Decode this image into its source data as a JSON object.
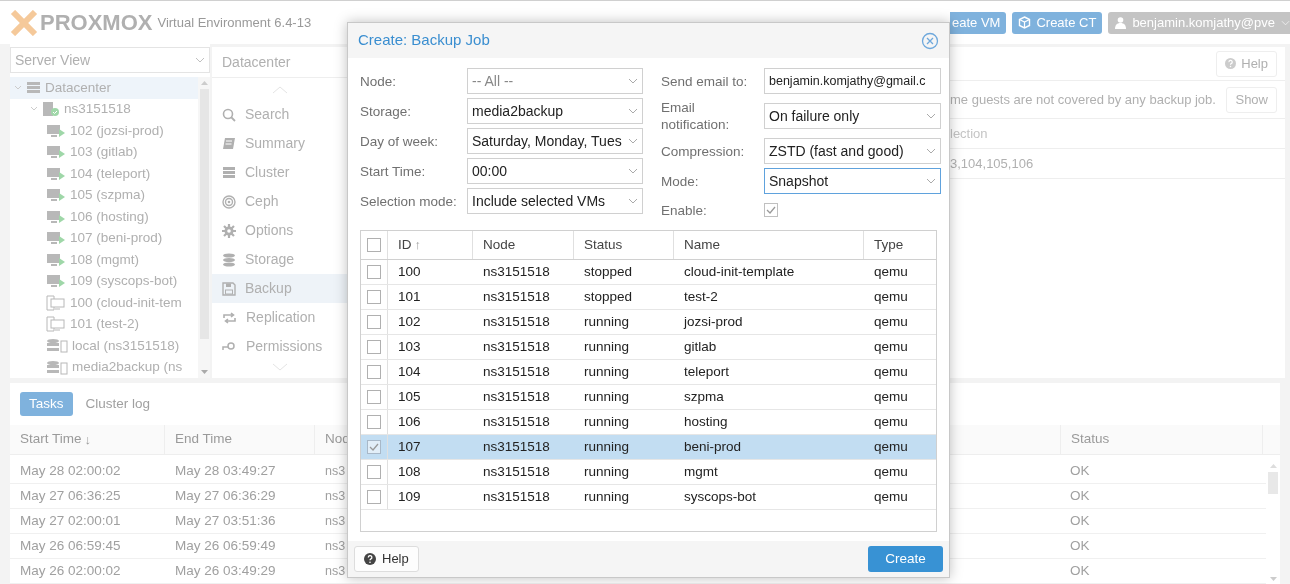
{
  "header": {
    "logo": "PROXMOX",
    "subtitle": "Virtual Environment 6.4-13",
    "buttons": [
      {
        "label": "eate VM",
        "kind": "plain"
      },
      {
        "label": "Create CT",
        "kind": "cube"
      }
    ],
    "user": "benjamin.komjathy@pve"
  },
  "tree": {
    "view_selector": "Server View",
    "items": [
      {
        "label": "Datacenter",
        "kind": "datacenter",
        "selected": true,
        "expanded": true,
        "children": [
          {
            "label": "ns3151518",
            "kind": "node",
            "selected": false,
            "expanded": true,
            "children": [
              {
                "label": "102 (jozsi-prod)",
                "kind": "vm",
                "selected": false
              },
              {
                "label": "103 (gitlab)",
                "kind": "vm",
                "selected": false
              },
              {
                "label": "104 (teleport)",
                "kind": "vm",
                "selected": false
              },
              {
                "label": "105 (szpma)",
                "kind": "vm",
                "selected": false
              },
              {
                "label": "106 (hosting)",
                "kind": "vm",
                "selected": false
              },
              {
                "label": "107 (beni-prod)",
                "kind": "vm",
                "selected": false
              },
              {
                "label": "108 (mgmt)",
                "kind": "vm",
                "selected": false
              },
              {
                "label": "109 (syscops-bot)",
                "kind": "vm",
                "selected": false
              },
              {
                "label": "100 (cloud-init-tem",
                "kind": "template",
                "selected": false
              },
              {
                "label": "101 (test-2)",
                "kind": "template",
                "selected": false
              },
              {
                "label": "local (ns3151518)",
                "kind": "storage",
                "selected": false
              },
              {
                "label": "media2backup (ns",
                "kind": "storage",
                "selected": false
              }
            ]
          }
        ]
      }
    ]
  },
  "nav": {
    "title": "Datacenter",
    "items": [
      {
        "label": "Search",
        "kind": "search",
        "selected": false
      },
      {
        "label": "Summary",
        "kind": "summary",
        "selected": false
      },
      {
        "label": "Cluster",
        "kind": "cluster",
        "selected": false
      },
      {
        "label": "Ceph",
        "kind": "ceph",
        "selected": false
      },
      {
        "label": "Options",
        "kind": "options",
        "selected": false
      },
      {
        "label": "Storage",
        "kind": "storage",
        "selected": false
      },
      {
        "label": "Backup",
        "kind": "backup",
        "selected": true
      },
      {
        "label": "Replication",
        "kind": "replication",
        "selected": false
      },
      {
        "label": "Permissions",
        "kind": "permissions",
        "selected": false
      }
    ]
  },
  "backup_panel": {
    "help": "Help",
    "notice": "me guests are not covered by any backup job.",
    "show_button": "Show",
    "columns": [
      "lection"
    ],
    "rows": [
      [
        "3,104,105,106"
      ]
    ]
  },
  "tasks": {
    "tabs": [
      {
        "label": "Tasks",
        "selected": true
      },
      {
        "label": "Cluster log",
        "selected": false
      }
    ],
    "columns": [
      {
        "label": "Start Time",
        "sort_icon": "↓"
      },
      {
        "label": "End Time"
      },
      {
        "label": "Nod"
      },
      {
        "label": "Status"
      }
    ],
    "rows": [
      {
        "start": "May 28 02:00:02",
        "end": "May 28 03:49:27",
        "node": "ns3",
        "status": "OK"
      },
      {
        "start": "May 27 06:36:25",
        "end": "May 27 06:36:29",
        "node": "ns3",
        "status": "OK"
      },
      {
        "start": "May 27 02:00:01",
        "end": "May 27 03:51:36",
        "node": "ns3",
        "status": "OK"
      },
      {
        "start": "May 26 06:59:45",
        "end": "May 26 06:59:49",
        "node": "ns3",
        "status": "OK"
      },
      {
        "start": "May 26 02:00:02",
        "end": "May 26 03:49:29",
        "node": "ns3",
        "status": "OK"
      }
    ]
  },
  "dialog": {
    "title": "Create: Backup Job",
    "left_fields": [
      {
        "label": "Node:",
        "kind": "combo",
        "placeholder": "-- All --"
      },
      {
        "label": "Storage:",
        "kind": "combo",
        "value": "media2backup"
      },
      {
        "label": "Day of week:",
        "kind": "combo",
        "value": "Saturday, Monday, Tues"
      },
      {
        "label": "Start Time:",
        "kind": "combo",
        "value": "00:00"
      },
      {
        "label": "Selection mode:",
        "kind": "combo",
        "value": "Include selected VMs"
      }
    ],
    "right_fields": [
      {
        "label": "Send email to:",
        "kind": "text",
        "value": "benjamin.komjathy@gmail.c"
      },
      {
        "label": "Email notification:",
        "kind": "combo",
        "value": "On failure only"
      },
      {
        "label": "Compression:",
        "kind": "combo",
        "value": "ZSTD (fast and good)"
      },
      {
        "label": "Mode:",
        "kind": "combo",
        "value": "Snapshot",
        "focused": true
      },
      {
        "label": "Enable:",
        "kind": "checkbox",
        "checked": true
      }
    ],
    "columns": [
      {
        "label": "ID",
        "sort_icon": "↑"
      },
      {
        "label": "Node"
      },
      {
        "label": "Status"
      },
      {
        "label": "Name"
      },
      {
        "label": "Type"
      }
    ],
    "header_checked": false,
    "rows": [
      {
        "id": "100",
        "node": "ns3151518",
        "status": "stopped",
        "name": "cloud-init-template",
        "type": "qemu",
        "checked": false,
        "selected": false
      },
      {
        "id": "101",
        "node": "ns3151518",
        "status": "stopped",
        "name": "test-2",
        "type": "qemu",
        "checked": false,
        "selected": false
      },
      {
        "id": "102",
        "node": "ns3151518",
        "status": "running",
        "name": "jozsi-prod",
        "type": "qemu",
        "checked": false,
        "selected": false
      },
      {
        "id": "103",
        "node": "ns3151518",
        "status": "running",
        "name": "gitlab",
        "type": "qemu",
        "checked": false,
        "selected": false
      },
      {
        "id": "104",
        "node": "ns3151518",
        "status": "running",
        "name": "teleport",
        "type": "qemu",
        "checked": false,
        "selected": false
      },
      {
        "id": "105",
        "node": "ns3151518",
        "status": "running",
        "name": "szpma",
        "type": "qemu",
        "checked": false,
        "selected": false
      },
      {
        "id": "106",
        "node": "ns3151518",
        "status": "running",
        "name": "hosting",
        "type": "qemu",
        "checked": false,
        "selected": false
      },
      {
        "id": "107",
        "node": "ns3151518",
        "status": "running",
        "name": "beni-prod",
        "type": "qemu",
        "checked": true,
        "selected": true
      },
      {
        "id": "108",
        "node": "ns3151518",
        "status": "running",
        "name": "mgmt",
        "type": "qemu",
        "checked": false,
        "selected": false
      },
      {
        "id": "109",
        "node": "ns3151518",
        "status": "running",
        "name": "syscops-bot",
        "type": "qemu",
        "checked": false,
        "selected": false
      }
    ],
    "help_button": "Help",
    "create_button": "Create"
  }
}
